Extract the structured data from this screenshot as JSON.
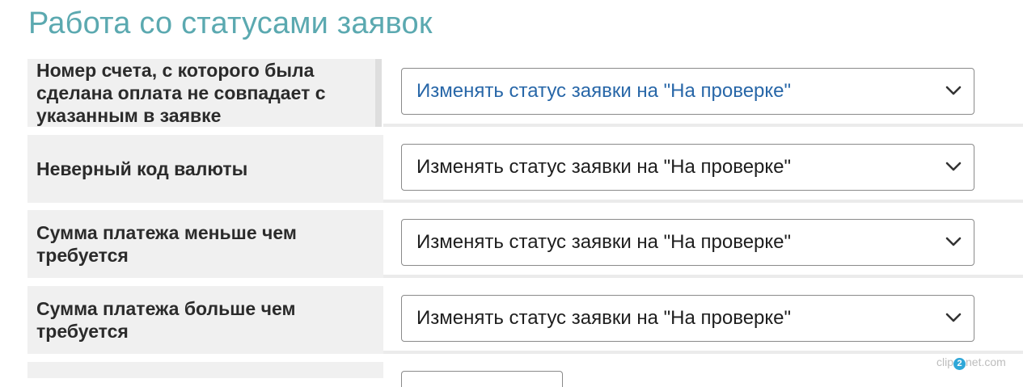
{
  "page": {
    "title": "Работа со статусами заявок"
  },
  "rules": [
    {
      "label": "Номер счета, с которого была сделана оплата не совпадает с указанным в заявке",
      "selected": "Изменять статус заявки на \"На проверке\"",
      "focused": true
    },
    {
      "label": "Неверный код валюты",
      "selected": "Изменять статус заявки на \"На проверке\"",
      "focused": false
    },
    {
      "label": "Сумма платежа меньше чем требуется",
      "selected": "Изменять статус заявки на \"На проверке\"",
      "focused": false
    },
    {
      "label": "Сумма платежа больше чем требуется",
      "selected": "Изменять статус заявки на \"На проверке\"",
      "focused": false
    }
  ],
  "icons": {
    "select_arrow": "chevron-down-icon"
  },
  "colors": {
    "title": "#5ba9b0",
    "focused_value": "#2867a8",
    "label_background": "#f0f0f0"
  },
  "watermark": {
    "prefix": "clip",
    "digit": "2",
    "suffix": "net",
    "domain": ".com"
  }
}
